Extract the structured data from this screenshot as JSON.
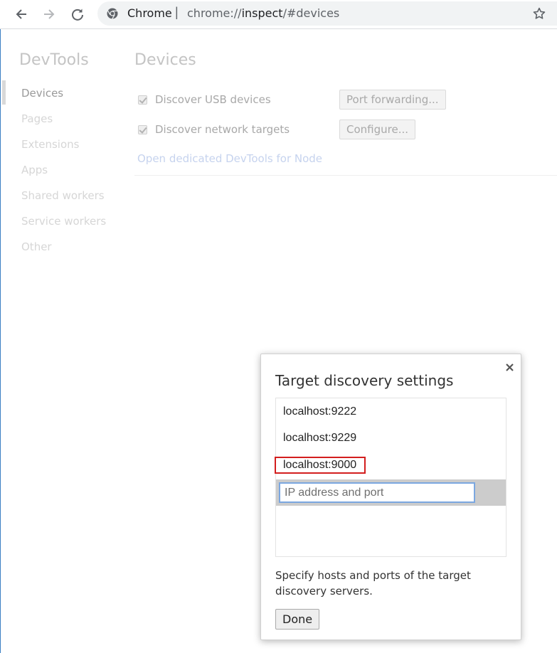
{
  "browser": {
    "site_label": "Chrome",
    "separator": "|",
    "url_prefix": "chrome://",
    "url_host": "inspect",
    "url_suffix": "/#devices"
  },
  "sidebar": {
    "title": "DevTools",
    "items": [
      {
        "label": "Devices"
      },
      {
        "label": "Pages"
      },
      {
        "label": "Extensions"
      },
      {
        "label": "Apps"
      },
      {
        "label": "Shared workers"
      },
      {
        "label": "Service workers"
      },
      {
        "label": "Other"
      }
    ]
  },
  "main": {
    "title": "Devices",
    "usb_label": "Discover USB devices",
    "port_forwarding_label": "Port forwarding...",
    "network_label": "Discover network targets",
    "configure_label": "Configure...",
    "node_link": "Open dedicated DevTools for Node"
  },
  "dialog": {
    "title": "Target discovery settings",
    "close_label": "×",
    "targets": [
      "localhost:9222",
      "localhost:9229",
      "localhost:9000"
    ],
    "input_placeholder": "IP address and port",
    "input_value": "",
    "help_text": "Specify hosts and ports of the target discovery servers.",
    "done_label": "Done"
  }
}
